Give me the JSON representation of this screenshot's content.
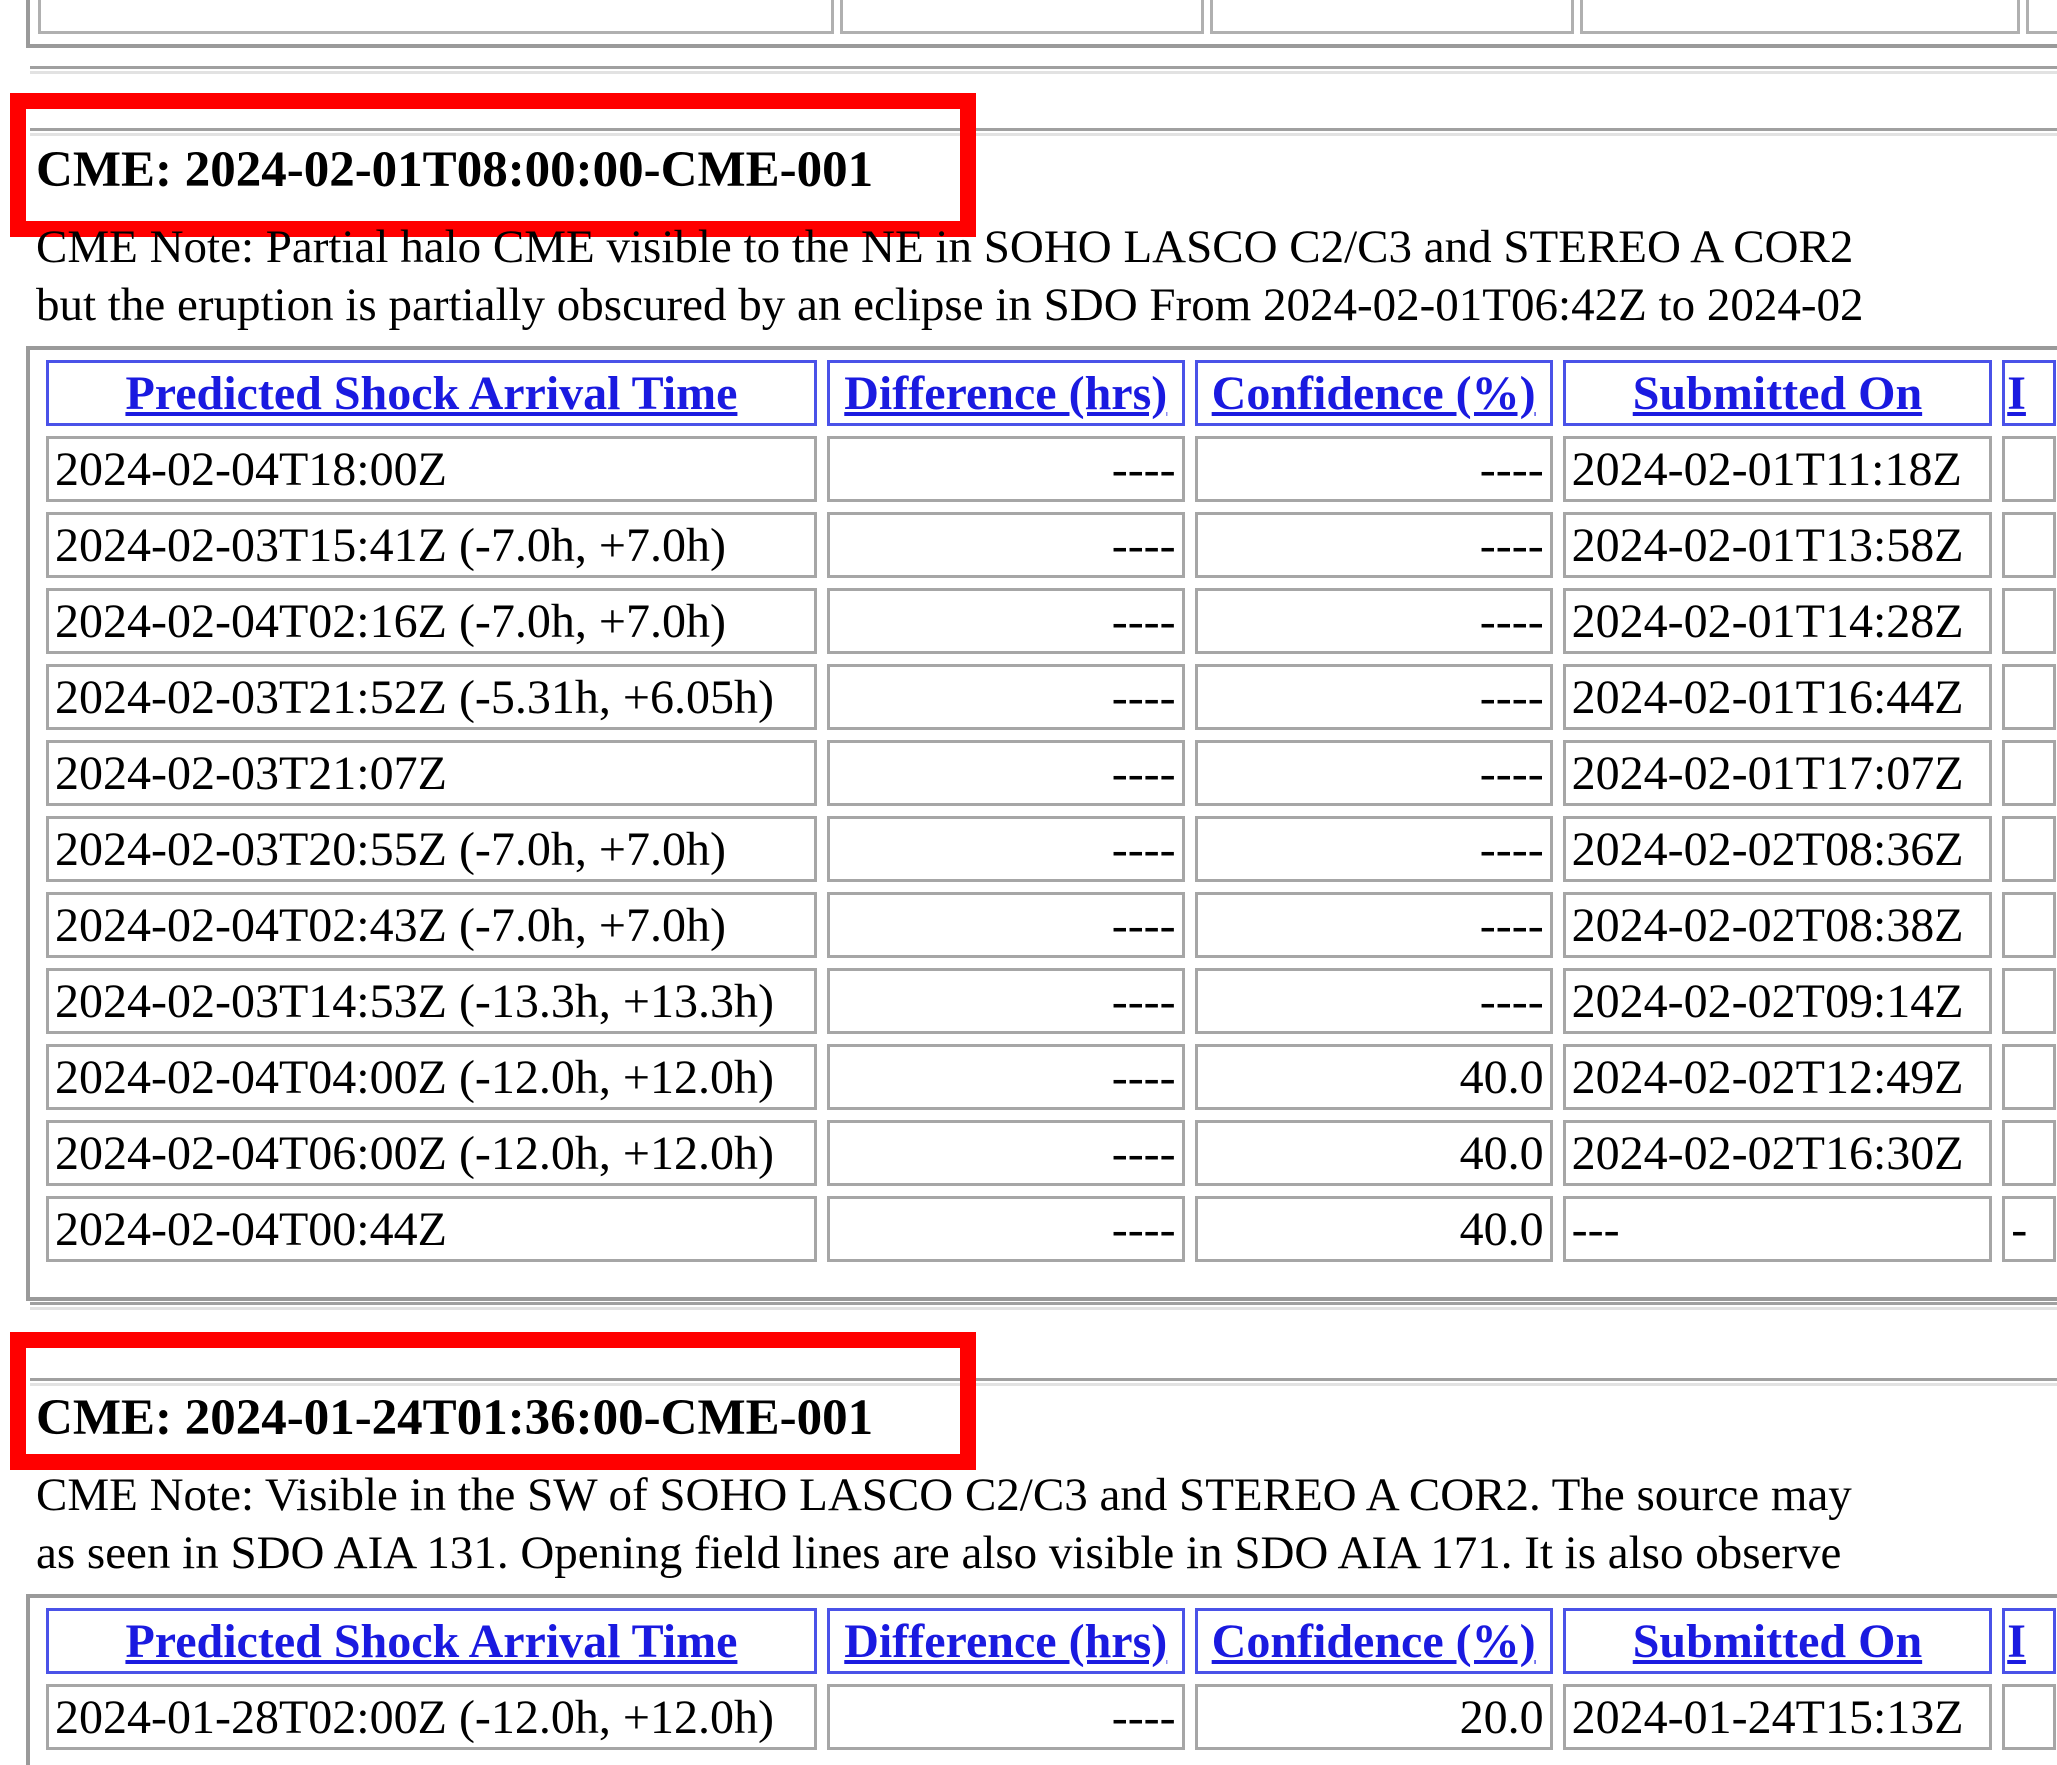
{
  "section1": {
    "title": "CME: 2024-02-01T08:00:00-CME-001",
    "note_line1": "CME Note: Partial halo CME visible to the NE in SOHO LASCO C2/C3 and STEREO A COR2",
    "note_line2": "but the eruption is partially obscured by an eclipse in SDO From 2024-02-01T06:42Z to 2024-02",
    "headers": [
      "Predicted Shock Arrival Time",
      "Difference (hrs)",
      "Confidence (%)",
      "Submitted On",
      "I"
    ],
    "rows": [
      [
        "2024-02-04T18:00Z",
        "----",
        "----",
        "2024-02-01T11:18Z",
        ""
      ],
      [
        "2024-02-03T15:41Z (-7.0h, +7.0h)",
        "----",
        "----",
        "2024-02-01T13:58Z",
        ""
      ],
      [
        "2024-02-04T02:16Z (-7.0h, +7.0h)",
        "----",
        "----",
        "2024-02-01T14:28Z",
        ""
      ],
      [
        "2024-02-03T21:52Z (-5.31h, +6.05h)",
        "----",
        "----",
        "2024-02-01T16:44Z",
        ""
      ],
      [
        "2024-02-03T21:07Z",
        "----",
        "----",
        "2024-02-01T17:07Z",
        ""
      ],
      [
        "2024-02-03T20:55Z (-7.0h, +7.0h)",
        "----",
        "----",
        "2024-02-02T08:36Z",
        ""
      ],
      [
        "2024-02-04T02:43Z (-7.0h, +7.0h)",
        "----",
        "----",
        "2024-02-02T08:38Z",
        ""
      ],
      [
        "2024-02-03T14:53Z (-13.3h, +13.3h)",
        "----",
        "----",
        "2024-02-02T09:14Z",
        ""
      ],
      [
        "2024-02-04T04:00Z (-12.0h, +12.0h)",
        "----",
        "40.0",
        "2024-02-02T12:49Z",
        ""
      ],
      [
        "2024-02-04T06:00Z (-12.0h, +12.0h)",
        "----",
        "40.0",
        "2024-02-02T16:30Z",
        ""
      ],
      [
        "2024-02-04T00:44Z",
        "----",
        "40.0",
        "---",
        "-"
      ]
    ]
  },
  "section2": {
    "title": "CME: 2024-01-24T01:36:00-CME-001",
    "note_line1": "CME Note: Visible in the SW of SOHO LASCO C2/C3 and STEREO A COR2. The source may",
    "note_line2": "as seen in SDO AIA 131. Opening field lines are also visible in SDO AIA 171. It is also observe",
    "headers": [
      "Predicted Shock Arrival Time",
      "Difference (hrs)",
      "Confidence (%)",
      "Submitted On",
      "I"
    ],
    "rows": [
      [
        "2024-01-28T02:00Z (-12.0h, +12.0h)",
        "----",
        "20.0",
        "2024-01-24T15:13Z",
        ""
      ]
    ]
  },
  "colors": {
    "highlight": "#ff0000",
    "link": "#1a1ae0",
    "header_border": "#4a52e8"
  }
}
